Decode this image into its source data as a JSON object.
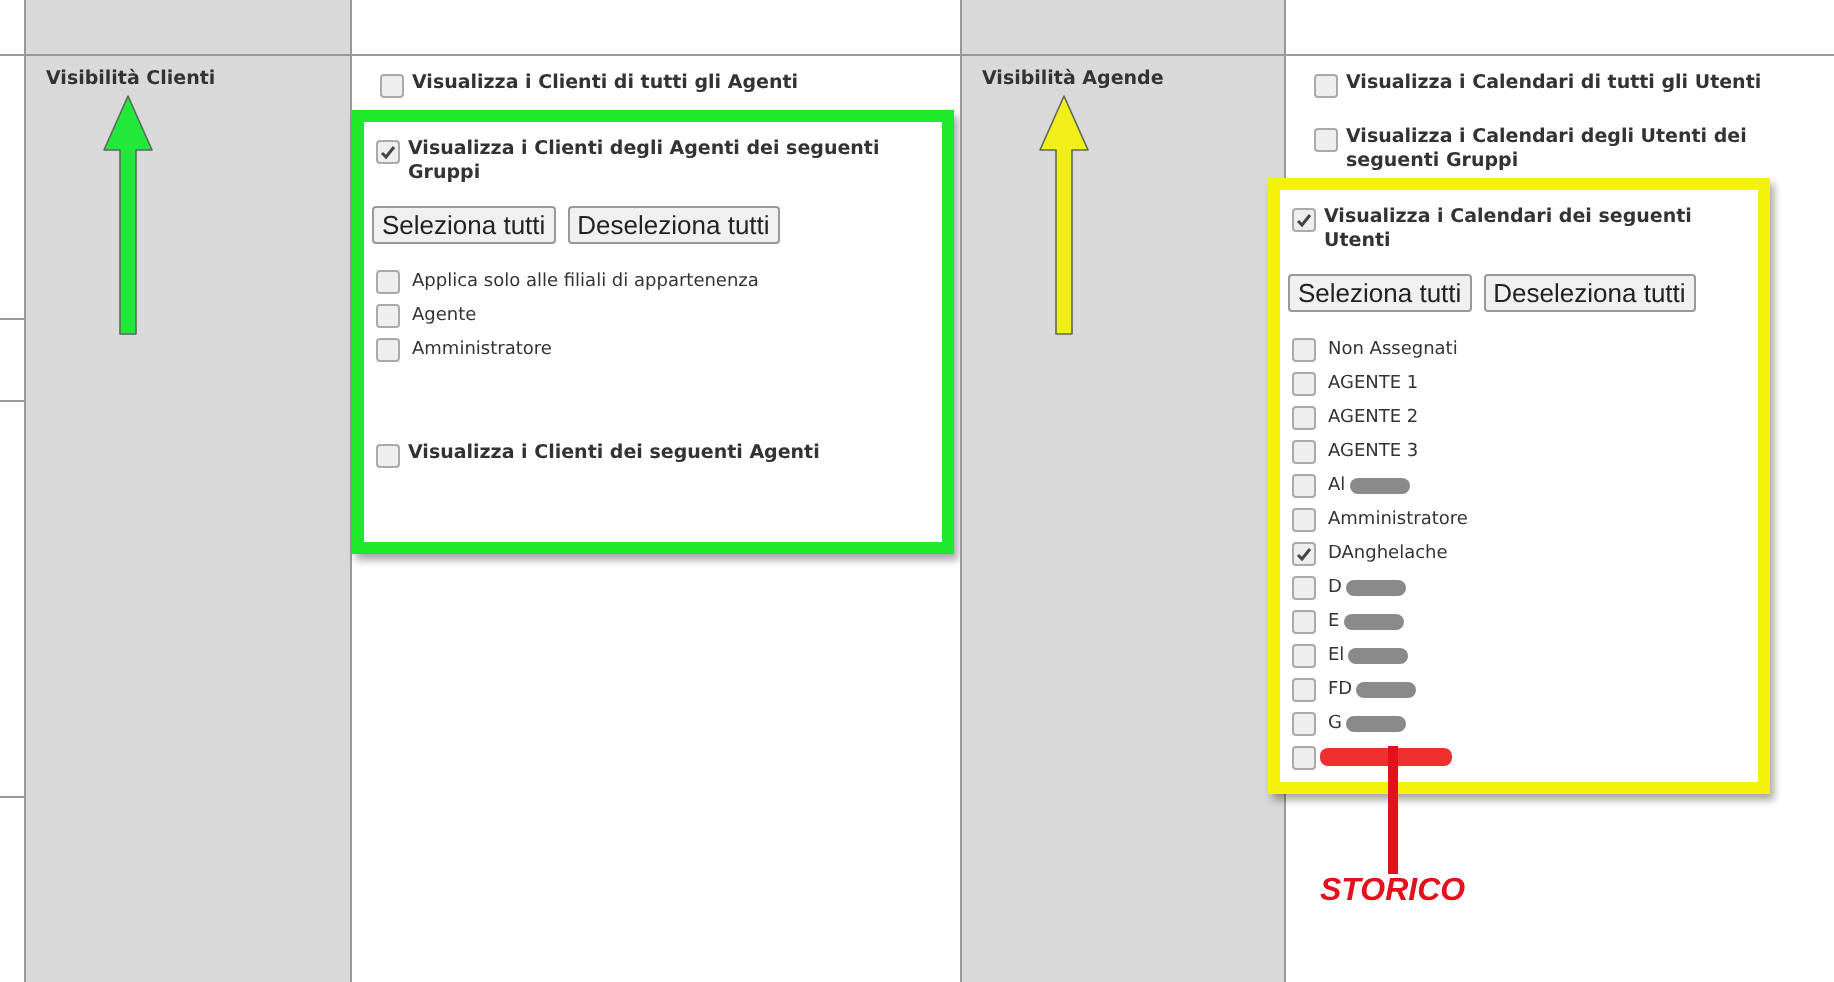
{
  "sections": [
    {
      "label": "Visibilità Clienti",
      "arrow": {
        "color": "#22e83a"
      },
      "options_before": [
        {
          "label": "Visualizza i Clienti di tutti gli Agenti",
          "checked": false
        }
      ],
      "highlight": {
        "color": "#1ee82a",
        "items": [
          {
            "kind": "checkbox",
            "label": "Visualizza i Clienti degli Agenti dei seguenti Gruppi",
            "checked": true
          },
          {
            "kind": "buttons",
            "buttons": [
              "Seleziona tutti",
              "Deseleziona tutti"
            ]
          },
          {
            "kind": "list",
            "items": [
              {
                "label": "Applica solo alle filiali di appartenenza",
                "checked": false
              },
              {
                "label": "Agente",
                "checked": false
              },
              {
                "label": "Amministratore",
                "checked": false
              }
            ]
          },
          {
            "kind": "spacer"
          },
          {
            "kind": "checkbox",
            "label": "Visualizza i Clienti dei seguenti Agenti",
            "checked": false
          }
        ]
      }
    },
    {
      "label": "Visibilità Agende",
      "arrow": {
        "color": "#f2ee1a"
      },
      "options_before": [
        {
          "label": "Visualizza i Calendari di tutti gli Utenti",
          "checked": false
        },
        {
          "label": "Visualizza i Calendari degli Utenti dei seguenti Gruppi",
          "checked": false
        }
      ],
      "highlight": {
        "color": "#f5f20a",
        "items": [
          {
            "kind": "checkbox",
            "label": "Visualizza i Calendari dei seguenti Utenti",
            "checked": true
          },
          {
            "kind": "buttons",
            "buttons": [
              "Seleziona tutti",
              "Deseleziona tutti"
            ]
          },
          {
            "kind": "list",
            "items": [
              {
                "label": "Non Assegnati",
                "checked": false
              },
              {
                "label": "AGENTE 1",
                "checked": false
              },
              {
                "label": "AGENTE 2",
                "checked": false
              },
              {
                "label": "AGENTE 3",
                "checked": false
              },
              {
                "label": "Al",
                "checked": false,
                "blurred": true
              },
              {
                "label": "Amministratore",
                "checked": false
              },
              {
                "label": "DAnghelache",
                "checked": true
              },
              {
                "label": "D",
                "checked": false,
                "blurred": true
              },
              {
                "label": "E",
                "checked": false,
                "blurred": true
              },
              {
                "label": "El",
                "checked": false,
                "blurred": true
              },
              {
                "label": "FD",
                "checked": false,
                "blurred": true
              },
              {
                "label": "G",
                "checked": false,
                "blurred": true
              },
              {
                "checked": false,
                "struck": true
              }
            ]
          }
        ],
        "note": {
          "text": "STORICO",
          "color": "#e4101c"
        }
      }
    }
  ]
}
